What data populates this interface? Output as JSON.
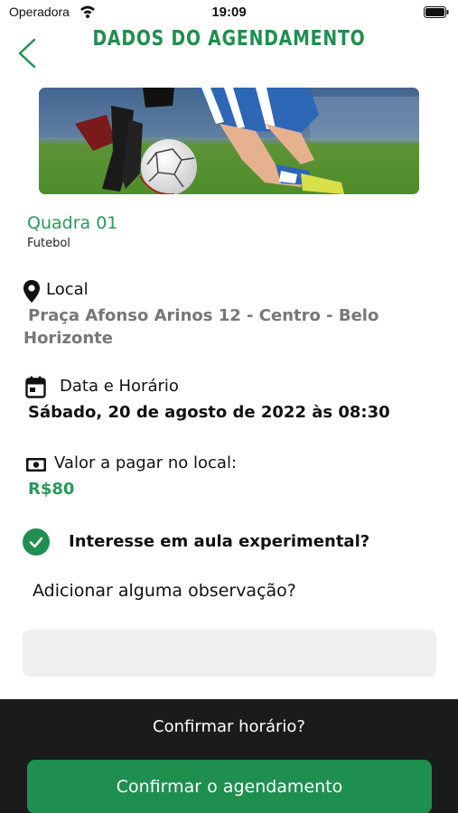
{
  "status_bar": {
    "carrier": "Operadora",
    "time": "19:09"
  },
  "header": {
    "title": "DADOS DO AGENDAMENTO"
  },
  "court": {
    "name": "Quadra 01",
    "sport": "Futebol"
  },
  "location": {
    "label": "Local",
    "value": "Praça Afonso Arinos 12 - Centro - Belo Horizonte"
  },
  "datetime": {
    "label": "Data e Horário",
    "value": "Sábado, 20 de agosto de 2022 às 08:30"
  },
  "price": {
    "label": "Valor a pagar no local:",
    "value": "R$80"
  },
  "trial_class": {
    "label": "Interesse em aula experimental?",
    "checked": true
  },
  "observation": {
    "label": "Adicionar alguma observação?",
    "value": "",
    "placeholder": ""
  },
  "footer": {
    "question": "Confirmar horário?",
    "confirm_label": "Confirmar o agendamento"
  },
  "colors": {
    "accent": "#1e8f4f",
    "footer_bg": "#1b1b1b",
    "input_bg": "#efefef"
  },
  "icons": [
    "wifi-icon",
    "battery-icon",
    "back-chevron-icon",
    "location-pin-icon",
    "calendar-icon",
    "cash-icon",
    "check-icon"
  ]
}
